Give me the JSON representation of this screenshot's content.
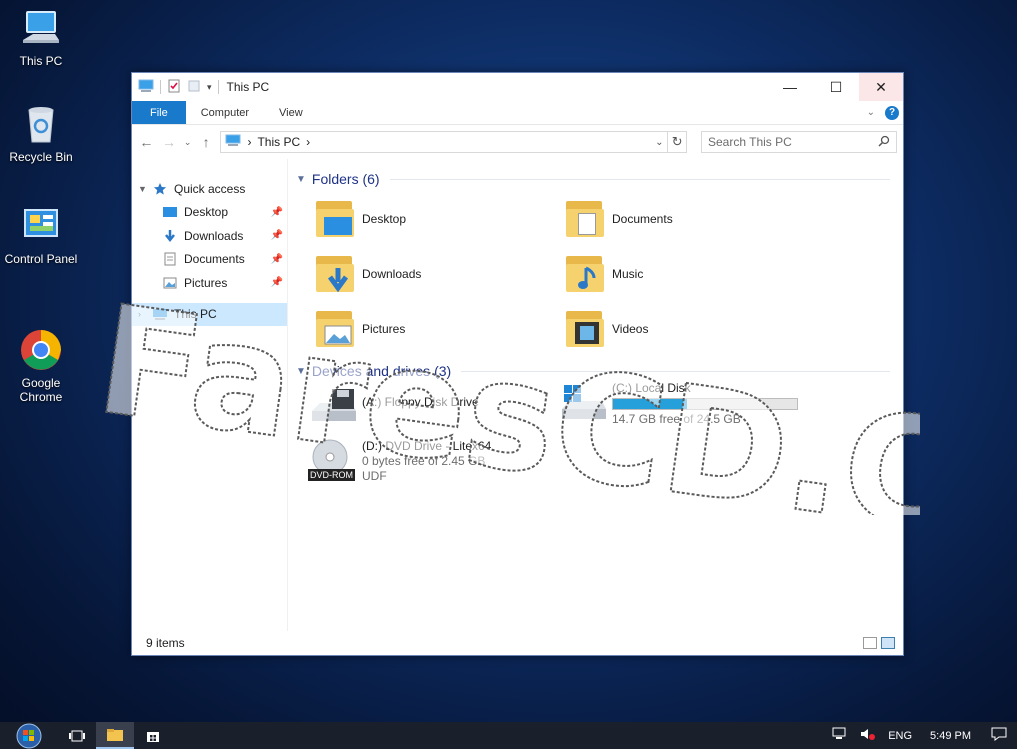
{
  "desktop": {
    "icons": [
      {
        "label": "This PC"
      },
      {
        "label": "Recycle Bin"
      },
      {
        "label": "Control Panel"
      },
      {
        "label": "Google\nChrome"
      }
    ]
  },
  "window": {
    "title": "This PC",
    "controls": {
      "minimize": "—",
      "maximize": "☐",
      "close": "✕"
    },
    "ribbon_tabs": [
      "File",
      "Computer",
      "View"
    ],
    "help": "?",
    "address": {
      "location": "This PC",
      "separator": "›"
    },
    "search_placeholder": "Search This PC",
    "nav": {
      "quick_access": "Quick access",
      "items": [
        "Desktop",
        "Downloads",
        "Documents",
        "Pictures"
      ],
      "this_pc": "This PC"
    },
    "folders_header": "Folders (6)",
    "folders": [
      "Desktop",
      "Documents",
      "Downloads",
      "Music",
      "Pictures",
      "Videos"
    ],
    "devices_header": "Devices and drives (3)",
    "drives": {
      "floppy": {
        "name": "(A:) Floppy Disk Drive"
      },
      "local": {
        "name": "(C:) Local Disk",
        "free": "14.7 GB free of 24.5 GB",
        "used_fraction": 0.4
      },
      "dvd": {
        "name": "(D:) DVD Drive - Litex64",
        "free": "0 bytes free of 2.45 GB",
        "fs": "UDF",
        "badge": "DVD-ROM"
      }
    },
    "status_text": "9 items"
  },
  "watermark": "FaresCD.Com",
  "taskbar": {
    "lang": "ENG",
    "time": "5:49 PM"
  },
  "colors": {
    "accent": "#1979ca",
    "selection": "#cce8ff",
    "progress": "#26a0da"
  }
}
